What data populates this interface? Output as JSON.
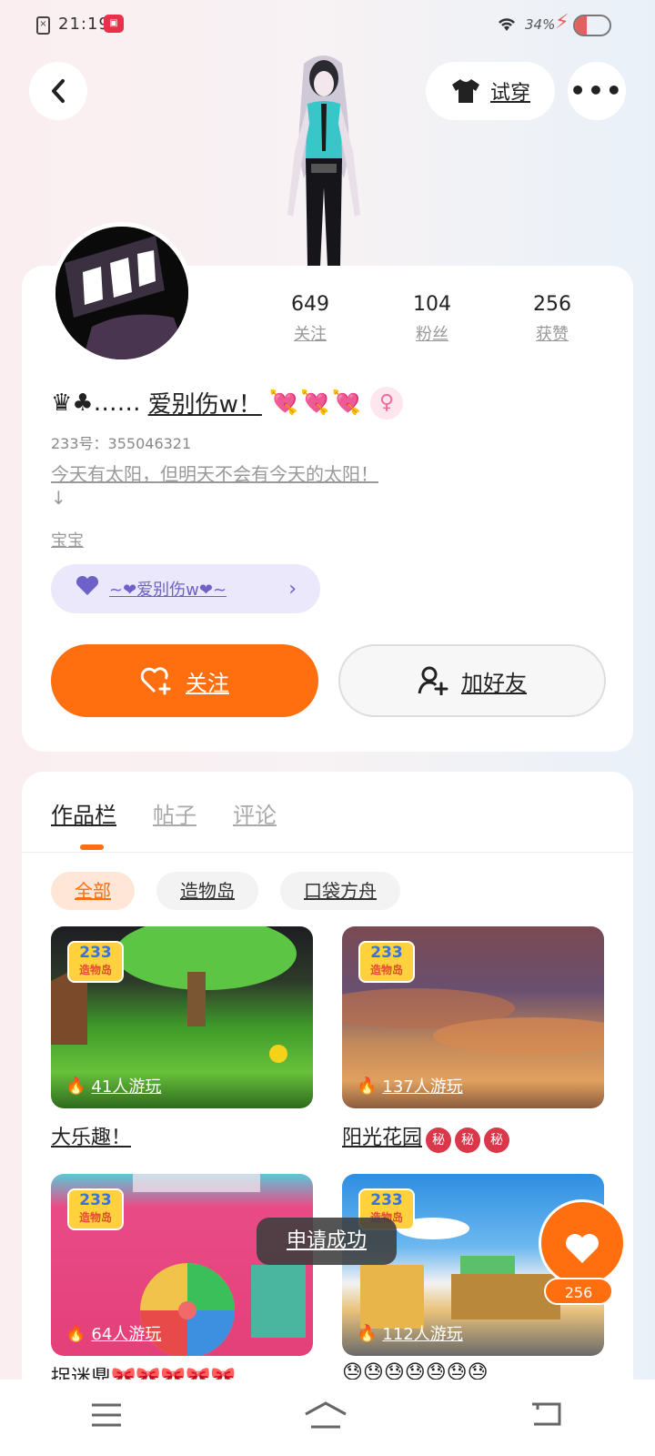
{
  "status_bar": {
    "time": "21:19",
    "battery": "34%",
    "battery_level": 0.34
  },
  "header": {
    "try_on_label": "试穿",
    "more_label": "•••"
  },
  "profile": {
    "stats": [
      {
        "value": "649",
        "label": "关注"
      },
      {
        "value": "104",
        "label": "粉丝"
      },
      {
        "value": "256",
        "label": "获赞"
      }
    ],
    "nickname_prefix": "♛♣……",
    "nickname": "爱别伤w！",
    "hearts": "💘💘💘",
    "gender_symbol": "♀",
    "user_id": "233号：355046321",
    "bio_line1": "今天有太阳，但明天不会有今天的太阳！",
    "bio_line2": "↓",
    "tag_text": "宝宝",
    "badge_label": "~❤爱别伤w❤~",
    "follow_label": "关注",
    "add_friend_label": "加好友"
  },
  "works": {
    "tabs": [
      "作品栏",
      "帖子",
      "评论"
    ],
    "filters": [
      "全部",
      "造物岛",
      "口袋方舟"
    ],
    "games": [
      {
        "plays": "41人游玩",
        "title": "大乐趣！",
        "secret_badges": []
      },
      {
        "plays": "137人游玩",
        "title": "阳光花园",
        "secret_badges": [
          "秘",
          "秘",
          "秘"
        ]
      },
      {
        "plays": "64人游玩",
        "title": "捉迷鼎🎀🎀🎀🎀🎀",
        "secret_badges": []
      },
      {
        "plays": "112人游玩",
        "title": "😓😓😓😓😓😓😓",
        "secret_badges": []
      }
    ],
    "logo_number": "233",
    "logo_text": "造物岛"
  },
  "toast": "申请成功",
  "like_count": "256",
  "colors": {
    "accent": "#ff6e0f",
    "badge_purple": "#6e62c9"
  }
}
